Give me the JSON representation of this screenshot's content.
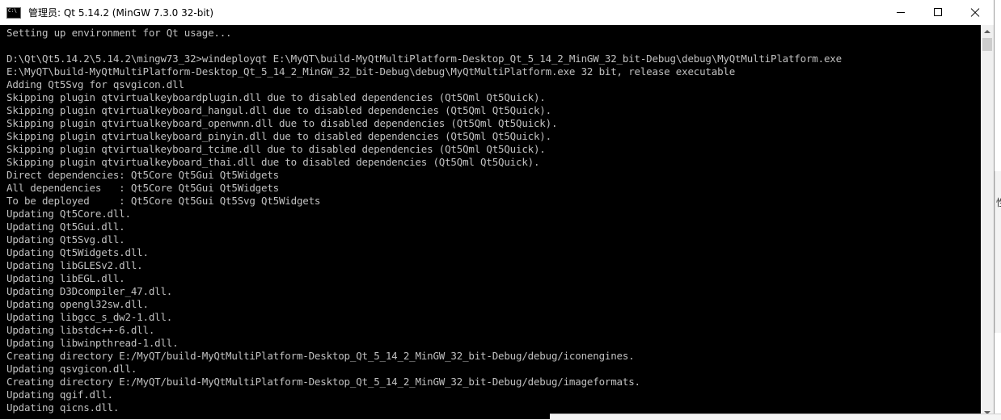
{
  "window": {
    "title": "管理员: Qt 5.14.2 (MinGW 7.3.0 32-bit)",
    "icon": "cmd-console-icon"
  },
  "controls": {
    "minimize": "minimize-icon",
    "maximize": "maximize-icon",
    "close": "close-icon"
  },
  "console": {
    "lines": [
      "Setting up environment for Qt usage...",
      "",
      "D:\\Qt\\Qt5.14.2\\5.14.2\\mingw73_32>windeployqt E:\\MyQT\\build-MyQtMultiPlatform-Desktop_Qt_5_14_2_MinGW_32_bit-Debug\\debug\\MyQtMultiPlatform.exe",
      "E:\\MyQT\\build-MyQtMultiPlatform-Desktop_Qt_5_14_2_MinGW_32_bit-Debug\\debug\\MyQtMultiPlatform.exe 32 bit, release executable",
      "Adding Qt5Svg for qsvgicon.dll",
      "Skipping plugin qtvirtualkeyboardplugin.dll due to disabled dependencies (Qt5Qml Qt5Quick).",
      "Skipping plugin qtvirtualkeyboard_hangul.dll due to disabled dependencies (Qt5Qml Qt5Quick).",
      "Skipping plugin qtvirtualkeyboard_openwnn.dll due to disabled dependencies (Qt5Qml Qt5Quick).",
      "Skipping plugin qtvirtualkeyboard_pinyin.dll due to disabled dependencies (Qt5Qml Qt5Quick).",
      "Skipping plugin qtvirtualkeyboard_tcime.dll due to disabled dependencies (Qt5Qml Qt5Quick).",
      "Skipping plugin qtvirtualkeyboard_thai.dll due to disabled dependencies (Qt5Qml Qt5Quick).",
      "Direct dependencies: Qt5Core Qt5Gui Qt5Widgets",
      "All dependencies   : Qt5Core Qt5Gui Qt5Widgets",
      "To be deployed     : Qt5Core Qt5Gui Qt5Svg Qt5Widgets",
      "Updating Qt5Core.dll.",
      "Updating Qt5Gui.dll.",
      "Updating Qt5Svg.dll.",
      "Updating Qt5Widgets.dll.",
      "Updating libGLESv2.dll.",
      "Updating libEGL.dll.",
      "Updating D3Dcompiler_47.dll.",
      "Updating opengl32sw.dll.",
      "Updating libgcc_s_dw2-1.dll.",
      "Updating libstdc++-6.dll.",
      "Updating libwinpthread-1.dll.",
      "Creating directory E:/MyQT/build-MyQtMultiPlatform-Desktop_Qt_5_14_2_MinGW_32_bit-Debug/debug/iconengines.",
      "Updating qsvgicon.dll.",
      "Creating directory E:/MyQT/build-MyQtMultiPlatform-Desktop_Qt_5_14_2_MinGW_32_bit-Debug/debug/imageformats.",
      "Updating qgif.dll.",
      "Updating qicns.dll."
    ]
  },
  "background": {
    "glyph": "性"
  },
  "colors": {
    "console_bg": "#000000",
    "console_text": "#c0c0c0",
    "titlebar_bg": "#ffffff",
    "scrollbar_bg": "#f0f0f0"
  }
}
